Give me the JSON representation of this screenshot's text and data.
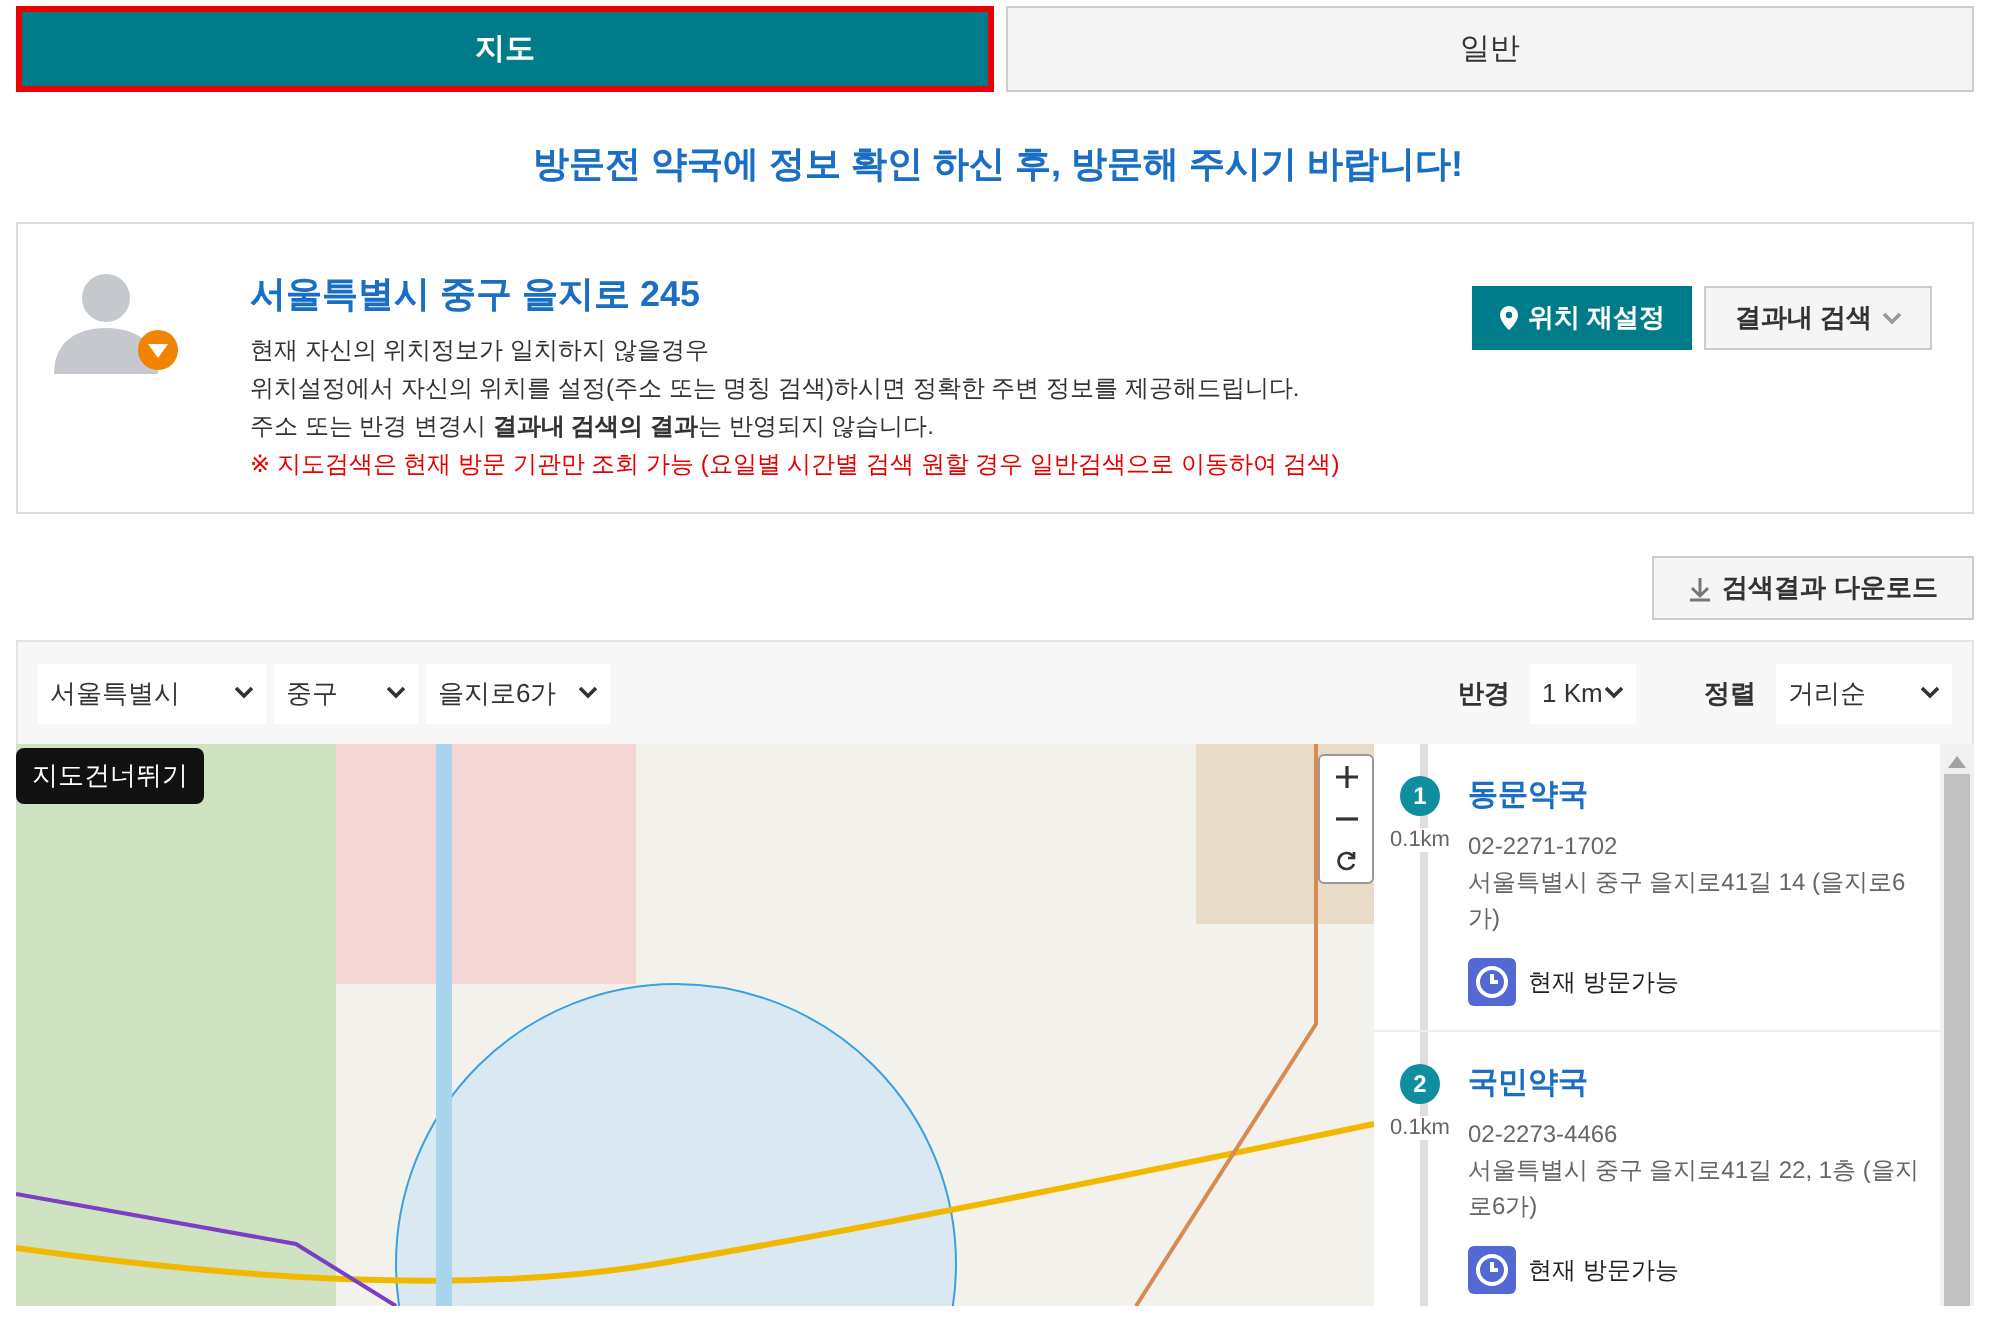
{
  "tabs": [
    {
      "label": "지도",
      "selected": true
    },
    {
      "label": "일반",
      "selected": false
    }
  ],
  "notice": "방문전 약국에 정보 확인 하신 후, 방문해 주시기 바랍니다!",
  "location": {
    "address": "서울특별시 중구 을지로 245",
    "lines": [
      "현재 자신의 위치정보가 일치하지 않을경우",
      "위치설정에서 자신의 위치를 설정(주소 또는 명칭 검색)하시면 정확한 주변 정보를 제공해드립니다.",
      "주소 또는 반경 변경시 **결과내 검색의 결과**는 반영되지 않습니다."
    ],
    "warning": "※ 지도검색은 현재 방문 기관만 조회 가능 (요일별 시간별 검색 원할 경우 일반검색으로 이동하여 검색)",
    "reset_button": "위치 재설정",
    "filter_button": "결과내 검색"
  },
  "download_button": "검색결과 다운로드",
  "filters": {
    "regions": [
      "서울특별시",
      "중구",
      "을지로6가"
    ],
    "radius_label": "반경",
    "radius": "1 Km",
    "sort_label": "정렬",
    "sort": "거리순"
  },
  "map": {
    "skip_button": "지도건너뛰기"
  },
  "results": [
    {
      "rank": "1",
      "name": "동문약국",
      "distance": "0.1km",
      "phone": "02-2271-1702",
      "address": "서울특별시 중구 을지로41길 14 (을지로6가)",
      "status": "현재 방문가능"
    },
    {
      "rank": "2",
      "name": "국민약국",
      "distance": "0.1km",
      "phone": "02-2273-4466",
      "address": "서울특별시 중구 을지로41길 22, 1층 (을지로6가)",
      "status": "현재 방문가능"
    }
  ]
}
